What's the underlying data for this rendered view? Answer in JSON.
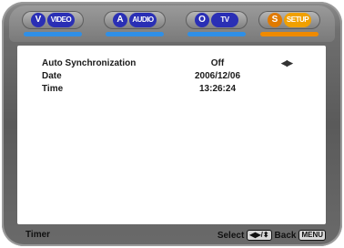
{
  "tabs": [
    {
      "badge": "V",
      "label": "VIDEO",
      "badge_color": "#2a2fb5",
      "label_color": "#2a2fb5",
      "underline_color": "#2f8fe6",
      "active": false
    },
    {
      "badge": "A",
      "label": "AUDIO",
      "badge_color": "#2a2fb5",
      "label_color": "#2a2fb5",
      "underline_color": "#2f8fe6",
      "active": false
    },
    {
      "badge": "O",
      "label": "TV",
      "badge_color": "#2a2fb5",
      "label_color": "#2a2fb5",
      "underline_color": "#2f8fe6",
      "active": false
    },
    {
      "badge": "S",
      "label": "SETUP",
      "badge_color": "#e07a00",
      "label_color": "#f0a000",
      "underline_color": "#f08a00",
      "active": true
    }
  ],
  "settings": [
    {
      "label": "Auto Synchronization",
      "value": "Off"
    },
    {
      "label": "Date",
      "value": "2006/12/06"
    },
    {
      "label": "Time",
      "value": "13:26:24"
    }
  ],
  "selector_arrows": "◀▶",
  "footer": {
    "title": "Timer",
    "select_label": "Select",
    "select_key": "◀▶/⬍",
    "back_label": "Back",
    "back_key": "MENU"
  }
}
